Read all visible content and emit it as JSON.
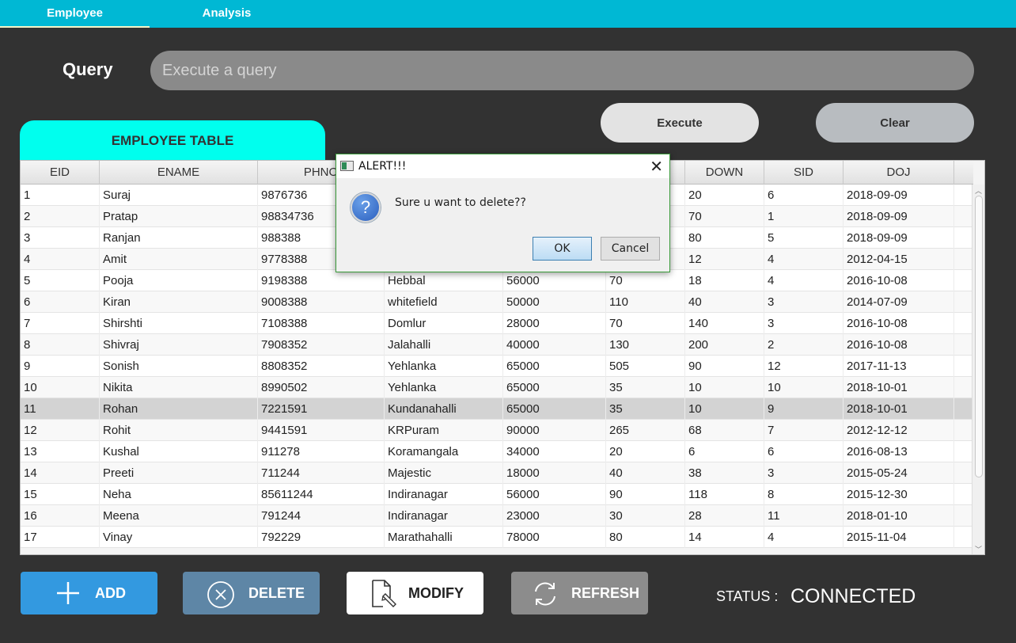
{
  "tabs": [
    {
      "label": "Employee",
      "active": true
    },
    {
      "label": "Analysis",
      "active": false
    }
  ],
  "query": {
    "label": "Query",
    "placeholder": "Execute a query",
    "execute_label": "Execute",
    "clear_label": "Clear"
  },
  "table": {
    "title": "EMPLOYEE TABLE",
    "columns": [
      "EID",
      "ENAME",
      "PHNO",
      "",
      "",
      "",
      "DOWN",
      "SID",
      "DOJ"
    ],
    "rows": [
      [
        "1",
        "Suraj",
        "9876736",
        "",
        "",
        "",
        "20",
        "6",
        "2018-09-09"
      ],
      [
        "2",
        "Pratap",
        "98834736",
        "",
        "",
        "",
        "70",
        "1",
        "2018-09-09"
      ],
      [
        "3",
        "Ranjan",
        "988388",
        "",
        "",
        "",
        "80",
        "5",
        "2018-09-09"
      ],
      [
        "4",
        "Amit",
        "9778388",
        "",
        "",
        "",
        "12",
        "4",
        "2012-04-15"
      ],
      [
        "5",
        "Pooja",
        "9198388",
        "Hebbal",
        "56000",
        "70",
        "18",
        "4",
        "2016-10-08"
      ],
      [
        "6",
        "Kiran",
        "9008388",
        "whitefield",
        "50000",
        "110",
        "40",
        "3",
        "2014-07-09"
      ],
      [
        "7",
        "Shirshti",
        "7108388",
        "Domlur",
        "28000",
        "70",
        "140",
        "3",
        "2016-10-08"
      ],
      [
        "8",
        "Shivraj",
        "7908352",
        "Jalahalli",
        "40000",
        "130",
        "200",
        "2",
        "2016-10-08"
      ],
      [
        "9",
        "Sonish",
        "8808352",
        "Yehlanka",
        "65000",
        "505",
        "90",
        "12",
        "2017-11-13"
      ],
      [
        "10",
        "Nikita",
        "8990502",
        "Yehlanka",
        "65000",
        "35",
        "10",
        "10",
        "2018-10-01"
      ],
      [
        "11",
        "Rohan",
        "7221591",
        "Kundanahalli",
        "65000",
        "35",
        "10",
        "9",
        "2018-10-01"
      ],
      [
        "12",
        "Rohit",
        "9441591",
        "KRPuram",
        "90000",
        "265",
        "68",
        "7",
        "2012-12-12"
      ],
      [
        "13",
        "Kushal",
        "911278",
        "Koramangala",
        "34000",
        "20",
        "6",
        "6",
        "2016-08-13"
      ],
      [
        "14",
        "Preeti",
        "711244",
        "Majestic",
        "18000",
        "40",
        "38",
        "3",
        "2015-05-24"
      ],
      [
        "15",
        "Neha",
        "85611244",
        "Indiranagar",
        "56000",
        "90",
        "118",
        "8",
        "2015-12-30"
      ],
      [
        "16",
        "Meena",
        "791244",
        "Indiranagar",
        "23000",
        "30",
        "28",
        "11",
        "2018-01-10"
      ],
      [
        "17",
        "Vinay",
        "792229",
        "Marathahalli",
        "78000",
        "80",
        "14",
        "4",
        "2015-11-04"
      ]
    ],
    "selected_row": 10
  },
  "actions": {
    "add_label": "ADD",
    "delete_label": "DELETE",
    "modify_label": "MODIFY",
    "refresh_label": "REFRESH"
  },
  "status": {
    "label": "STATUS :",
    "value": "CONNECTED"
  },
  "dialog": {
    "title": "ALERT!!!",
    "message": "Sure u want to delete??",
    "ok_label": "OK",
    "cancel_label": "Cancel",
    "close_glyph": "✕",
    "question_glyph": "?"
  },
  "colors": {
    "background": "#323232",
    "tabbar": "#00b8d4",
    "table_tab": "#00ffee",
    "add": "#3399e0",
    "delete": "#5e86a6",
    "refresh": "#8c8c8c"
  }
}
